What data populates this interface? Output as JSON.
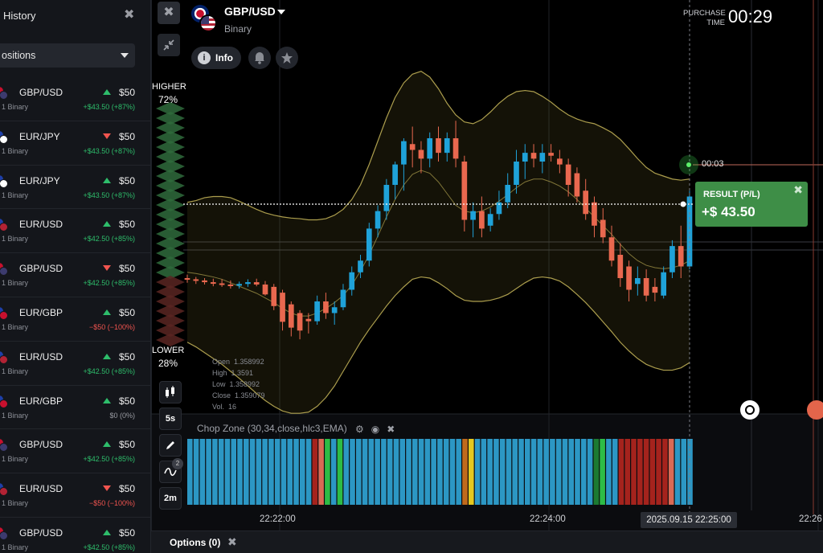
{
  "sidebar": {
    "title": "History",
    "filter_label": "ositions",
    "items": [
      {
        "pair": "GBP/USD",
        "type": "1 Binary",
        "direction": "up",
        "amount": "$50",
        "result": "+$43.50 (+87%)",
        "result_kind": "pos",
        "flag_a": "#c8102e",
        "flag_b": "#3c3b6e"
      },
      {
        "pair": "EUR/JPY",
        "type": "1 Binary",
        "direction": "down",
        "amount": "$50",
        "result": "+$43.50 (+87%)",
        "result_kind": "pos",
        "flag_a": "#1e3fa8",
        "flag_b": "#ffffff"
      },
      {
        "pair": "EUR/JPY",
        "type": "1 Binary",
        "direction": "up",
        "amount": "$50",
        "result": "+$43.50 (+87%)",
        "result_kind": "pos",
        "flag_a": "#1e3fa8",
        "flag_b": "#ffffff"
      },
      {
        "pair": "EUR/USD",
        "type": "1 Binary",
        "direction": "up",
        "amount": "$50",
        "result": "+$42.50 (+85%)",
        "result_kind": "pos",
        "flag_a": "#1e3fa8",
        "flag_b": "#b22234"
      },
      {
        "pair": "GBP/USD",
        "type": "1 Binary",
        "direction": "down",
        "amount": "$50",
        "result": "+$42.50 (+85%)",
        "result_kind": "pos",
        "flag_a": "#c8102e",
        "flag_b": "#3c3b6e"
      },
      {
        "pair": "EUR/GBP",
        "type": "1 Binary",
        "direction": "up",
        "amount": "$50",
        "result": "−$50 (−100%)",
        "result_kind": "neg",
        "flag_a": "#1e3fa8",
        "flag_b": "#c8102e"
      },
      {
        "pair": "EUR/USD",
        "type": "1 Binary",
        "direction": "up",
        "amount": "$50",
        "result": "+$42.50 (+85%)",
        "result_kind": "pos",
        "flag_a": "#1e3fa8",
        "flag_b": "#b22234"
      },
      {
        "pair": "EUR/GBP",
        "type": "1 Binary",
        "direction": "up",
        "amount": "$50",
        "result": "$0 (0%)",
        "result_kind": "zero",
        "flag_a": "#1e3fa8",
        "flag_b": "#c8102e"
      },
      {
        "pair": "GBP/USD",
        "type": "1 Binary",
        "direction": "up",
        "amount": "$50",
        "result": "+$42.50 (+85%)",
        "result_kind": "pos",
        "flag_a": "#c8102e",
        "flag_b": "#3c3b6e"
      },
      {
        "pair": "EUR/USD",
        "type": "1 Binary",
        "direction": "down",
        "amount": "$50",
        "result": "−$50 (−100%)",
        "result_kind": "neg",
        "flag_a": "#1e3fa8",
        "flag_b": "#b22234"
      },
      {
        "pair": "GBP/USD",
        "type": "1 Binary",
        "direction": "up",
        "amount": "$50",
        "result": "+$42.50 (+85%)",
        "result_kind": "pos",
        "flag_a": "#c8102e",
        "flag_b": "#3c3b6e"
      }
    ]
  },
  "header": {
    "asset_name": "GBP/USD",
    "asset_type": "Binary",
    "info_label": "Info",
    "info_icon": "i",
    "bell_icon": "bell-icon",
    "star_icon": "star-icon",
    "close_glyph": "✖",
    "purchase_label": "PURCHASE TIME",
    "purchase_time": "00:29"
  },
  "sentiment": {
    "higher_label": "HIGHER",
    "higher_pct": "72%",
    "lower_label": "LOWER",
    "lower_pct": "28%"
  },
  "tools": {
    "timeframe": "5s",
    "candle_period": "2m",
    "drawings_count": "2"
  },
  "ohlc": {
    "open_label": "Open",
    "open": "1.358992",
    "high_label": "High",
    "high": "1.3591",
    "low_label": "Low",
    "low": "1.358992",
    "close_label": "Close",
    "close": "1.359079",
    "vol_label": "Vol.",
    "vol": "16"
  },
  "indicator": {
    "label": "Chop Zone (30,34,close,hlc3,EMA)"
  },
  "result": {
    "title": "RESULT (P/L)",
    "value": "+$ 43.50",
    "timer": "00:03"
  },
  "time_axis": {
    "labels": [
      "22:22:00",
      "22:24:00",
      "22:26"
    ],
    "current": "2025.09.15 22:25:00"
  },
  "bottom": {
    "options_label": "Options (0)"
  },
  "colors": {
    "bull": "#1fa2d9",
    "bear": "#e9684f",
    "band_line": "#c9b95a",
    "result_bg": "#3e8e47"
  },
  "chart_data": {
    "type": "candlestick",
    "title": "",
    "candles": [
      {
        "o": 1.3586,
        "h": 1.35866,
        "l": 1.35852,
        "c": 1.35858
      },
      {
        "o": 1.35858,
        "h": 1.35862,
        "l": 1.3585,
        "c": 1.35856
      },
      {
        "o": 1.35856,
        "h": 1.3586,
        "l": 1.35849,
        "c": 1.35853
      },
      {
        "o": 1.35853,
        "h": 1.35859,
        "l": 1.35846,
        "c": 1.35851
      },
      {
        "o": 1.35851,
        "h": 1.35858,
        "l": 1.35845,
        "c": 1.35849
      },
      {
        "o": 1.35849,
        "h": 1.35856,
        "l": 1.35842,
        "c": 1.35847
      },
      {
        "o": 1.35847,
        "h": 1.35854,
        "l": 1.35842,
        "c": 1.3585
      },
      {
        "o": 1.3585,
        "h": 1.35858,
        "l": 1.35845,
        "c": 1.35853
      },
      {
        "o": 1.35853,
        "h": 1.35859,
        "l": 1.35846,
        "c": 1.35849
      },
      {
        "o": 1.35849,
        "h": 1.35855,
        "l": 1.3583,
        "c": 1.35832
      },
      {
        "o": 1.35845,
        "h": 1.3585,
        "l": 1.35805,
        "c": 1.35812
      },
      {
        "o": 1.35835,
        "h": 1.3584,
        "l": 1.3577,
        "c": 1.35785
      },
      {
        "o": 1.35815,
        "h": 1.3582,
        "l": 1.3576,
        "c": 1.35775
      },
      {
        "o": 1.358,
        "h": 1.35805,
        "l": 1.35755,
        "c": 1.3577
      },
      {
        "o": 1.3579,
        "h": 1.358,
        "l": 1.35765,
        "c": 1.35786
      },
      {
        "o": 1.35786,
        "h": 1.3583,
        "l": 1.3578,
        "c": 1.3582
      },
      {
        "o": 1.3582,
        "h": 1.35835,
        "l": 1.3579,
        "c": 1.358
      },
      {
        "o": 1.358,
        "h": 1.3582,
        "l": 1.3578,
        "c": 1.3581
      },
      {
        "o": 1.3581,
        "h": 1.3585,
        "l": 1.35805,
        "c": 1.3584
      },
      {
        "o": 1.3584,
        "h": 1.3588,
        "l": 1.3583,
        "c": 1.3587
      },
      {
        "o": 1.3587,
        "h": 1.359,
        "l": 1.3586,
        "c": 1.3589
      },
      {
        "o": 1.3589,
        "h": 1.35955,
        "l": 1.3588,
        "c": 1.35945
      },
      {
        "o": 1.35945,
        "h": 1.35985,
        "l": 1.3593,
        "c": 1.35975
      },
      {
        "o": 1.35975,
        "h": 1.3603,
        "l": 1.3596,
        "c": 1.3602
      },
      {
        "o": 1.3602,
        "h": 1.3606,
        "l": 1.35995,
        "c": 1.36055
      },
      {
        "o": 1.36055,
        "h": 1.361,
        "l": 1.3601,
        "c": 1.36095
      },
      {
        "o": 1.3609,
        "h": 1.3612,
        "l": 1.3605,
        "c": 1.3608
      },
      {
        "o": 1.3608,
        "h": 1.36095,
        "l": 1.3604,
        "c": 1.36065
      },
      {
        "o": 1.36065,
        "h": 1.3611,
        "l": 1.3605,
        "c": 1.361
      },
      {
        "o": 1.361,
        "h": 1.3612,
        "l": 1.3606,
        "c": 1.36075
      },
      {
        "o": 1.36075,
        "h": 1.3611,
        "l": 1.3606,
        "c": 1.361
      },
      {
        "o": 1.361,
        "h": 1.3613,
        "l": 1.3605,
        "c": 1.36065
      },
      {
        "o": 1.3606,
        "h": 1.3607,
        "l": 1.3594,
        "c": 1.3596
      },
      {
        "o": 1.3596,
        "h": 1.3599,
        "l": 1.3593,
        "c": 1.35975
      },
      {
        "o": 1.35975,
        "h": 1.36,
        "l": 1.3593,
        "c": 1.35945
      },
      {
        "o": 1.3595,
        "h": 1.3598,
        "l": 1.3594,
        "c": 1.3597
      },
      {
        "o": 1.3597,
        "h": 1.3601,
        "l": 1.3596,
        "c": 1.3599
      },
      {
        "o": 1.3599,
        "h": 1.3604,
        "l": 1.3598,
        "c": 1.3602
      },
      {
        "o": 1.3602,
        "h": 1.3608,
        "l": 1.36005,
        "c": 1.3606
      },
      {
        "o": 1.3606,
        "h": 1.3609,
        "l": 1.3603,
        "c": 1.36075
      },
      {
        "o": 1.36075,
        "h": 1.3609,
        "l": 1.3605,
        "c": 1.36065
      },
      {
        "o": 1.3606,
        "h": 1.3609,
        "l": 1.3604,
        "c": 1.36075
      },
      {
        "o": 1.36075,
        "h": 1.3609,
        "l": 1.3606,
        "c": 1.3607
      },
      {
        "o": 1.36065,
        "h": 1.3608,
        "l": 1.3604,
        "c": 1.36055
      },
      {
        "o": 1.36055,
        "h": 1.36065,
        "l": 1.36,
        "c": 1.3602
      },
      {
        "o": 1.3604,
        "h": 1.3605,
        "l": 1.3599,
        "c": 1.36
      },
      {
        "o": 1.3601,
        "h": 1.3603,
        "l": 1.3596,
        "c": 1.3597
      },
      {
        "o": 1.3599,
        "h": 1.36,
        "l": 1.3593,
        "c": 1.3595
      },
      {
        "o": 1.3596,
        "h": 1.3598,
        "l": 1.3592,
        "c": 1.3593
      },
      {
        "o": 1.3593,
        "h": 1.3595,
        "l": 1.3588,
        "c": 1.3589
      },
      {
        "o": 1.359,
        "h": 1.3592,
        "l": 1.35845,
        "c": 1.3586
      },
      {
        "o": 1.3588,
        "h": 1.3589,
        "l": 1.3582,
        "c": 1.3584
      },
      {
        "o": 1.3585,
        "h": 1.3588,
        "l": 1.3583,
        "c": 1.3586
      },
      {
        "o": 1.3586,
        "h": 1.35875,
        "l": 1.3582,
        "c": 1.3583
      },
      {
        "o": 1.35845,
        "h": 1.3586,
        "l": 1.3582,
        "c": 1.35835
      },
      {
        "o": 1.3583,
        "h": 1.3588,
        "l": 1.35825,
        "c": 1.3587
      },
      {
        "o": 1.3587,
        "h": 1.35925,
        "l": 1.3586,
        "c": 1.35915
      },
      {
        "o": 1.35915,
        "h": 1.3595,
        "l": 1.3586,
        "c": 1.3588
      },
      {
        "o": 1.3588,
        "h": 1.3601,
        "l": 1.35875,
        "c": 1.36
      }
    ],
    "upper_band": [
      1.3599,
      1.35993,
      1.35998,
      1.36,
      1.36,
      1.35998,
      1.35992,
      1.35985,
      1.35978,
      1.35972,
      1.35968,
      1.35965,
      1.35963,
      1.35962,
      1.3596,
      1.3596,
      1.35962,
      1.35968,
      1.35978,
      1.35995,
      1.3602,
      1.36055,
      1.36095,
      1.36135,
      1.3617,
      1.36195,
      1.3621,
      1.36215,
      1.36205,
      1.36185,
      1.3616,
      1.3614,
      1.36128,
      1.36125,
      1.36132,
      1.36145,
      1.3616,
      1.36172,
      1.3618,
      1.36182,
      1.3618,
      1.36172,
      1.36162,
      1.3615,
      1.3614,
      1.36133,
      1.36128,
      1.36125,
      1.36118,
      1.3611,
      1.36098,
      1.36082,
      1.36065,
      1.3605,
      1.3604,
      1.36035,
      1.3603,
      1.36028,
      1.3603
    ],
    "middle_band": [
      1.3587,
      1.35868,
      1.35865,
      1.35862,
      1.35858,
      1.35852,
      1.35846,
      1.3584,
      1.35834,
      1.35826,
      1.35818,
      1.35808,
      1.358,
      1.35795,
      1.35795,
      1.358,
      1.35808,
      1.35818,
      1.3583,
      1.35848,
      1.35872,
      1.359,
      1.35932,
      1.35965,
      1.35995,
      1.3602,
      1.36038,
      1.36045,
      1.3604,
      1.36025,
      1.36005,
      1.35985,
      1.35975,
      1.35972,
      1.35975,
      1.35982,
      1.35992,
      1.36003,
      1.36015,
      1.36025,
      1.3603,
      1.3603,
      1.36025,
      1.36018,
      1.36008,
      1.35995,
      1.3598,
      1.35965,
      1.3595,
      1.35935,
      1.35918,
      1.35902,
      1.3589,
      1.35882,
      1.35878,
      1.35876,
      1.35878,
      1.35882,
      1.3589
    ],
    "lower_band": [
      1.3575,
      1.35742,
      1.35732,
      1.35722,
      1.35712,
      1.357,
      1.35688,
      1.35675,
      1.35662,
      1.3565,
      1.3564,
      1.35632,
      1.35628,
      1.35628,
      1.3563,
      1.3564,
      1.35655,
      1.35675,
      1.357,
      1.35725,
      1.3575,
      1.35772,
      1.35792,
      1.35812,
      1.3583,
      1.35845,
      1.35858,
      1.35862,
      1.3586,
      1.35852,
      1.35842,
      1.3583,
      1.35822,
      1.3582,
      1.3582,
      1.35822,
      1.35826,
      1.35832,
      1.35842,
      1.35852,
      1.3586,
      1.35862,
      1.3586,
      1.35855,
      1.35845,
      1.35832,
      1.35818,
      1.35802,
      1.35785,
      1.35768,
      1.3575,
      1.35735,
      1.35722,
      1.35712,
      1.35706,
      1.35702,
      1.35702,
      1.35706,
      1.35715
    ],
    "chop_zone": [
      "b",
      "b",
      "b",
      "b",
      "b",
      "b",
      "b",
      "b",
      "b",
      "b",
      "b",
      "b",
      "b",
      "b",
      "b",
      "b",
      "b",
      "b",
      "b",
      "b",
      "r",
      "s",
      "g",
      "b",
      "g",
      "b",
      "b",
      "b",
      "b",
      "b",
      "b",
      "b",
      "b",
      "b",
      "b",
      "b",
      "b",
      "b",
      "b",
      "b",
      "b",
      "b",
      "b",
      "b",
      "o",
      "y",
      "b",
      "b",
      "b",
      "b",
      "b",
      "b",
      "b",
      "b",
      "b",
      "b",
      "b",
      "b",
      "b",
      "b",
      "b",
      "b",
      "b",
      "b",
      "b",
      "dg",
      "g",
      "b",
      "b",
      "r",
      "r",
      "r",
      "r",
      "r",
      "r",
      "r",
      "r",
      "s",
      "b",
      "b",
      "b"
    ],
    "chop_colors": {
      "b": "#2c97c4",
      "r": "#a5231d",
      "s": "#d96a55",
      "g": "#2dbc46",
      "dg": "#1c7a31",
      "o": "#c06a1d",
      "y": "#e4c81f"
    }
  }
}
